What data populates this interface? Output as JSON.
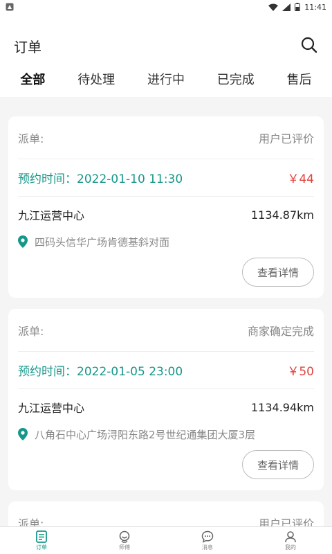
{
  "status_bar": {
    "time": "11:41",
    "notification_icon": "app-notification-icon"
  },
  "header": {
    "title": "订单",
    "search_icon": "search-icon",
    "tabs": [
      {
        "label": "全部",
        "active": true
      },
      {
        "label": "待处理",
        "active": false
      },
      {
        "label": "进行中",
        "active": false
      },
      {
        "label": "已完成",
        "active": false
      },
      {
        "label": "售后",
        "active": false
      }
    ]
  },
  "orders": [
    {
      "type_label": "派单:",
      "status": "用户已评价",
      "time_label": "预约时间：",
      "time_value": "2022-01-10 11:30",
      "price": "￥44",
      "center": "九江运营中心",
      "distance": "1134.87km",
      "address": "四码头信华广场肯德基斜对面",
      "detail_button": "查看详情"
    },
    {
      "type_label": "派单:",
      "status": "商家确定完成",
      "time_label": "预约时间：",
      "time_value": "2022-01-05 23:00",
      "price": "￥50",
      "center": "九江运营中心",
      "distance": "1134.94km",
      "address": "八角石中心广场浔阳东路2号世纪通集团大厦3层",
      "detail_button": "查看详情"
    },
    {
      "type_label": "派单:",
      "status": "用户已评价"
    }
  ],
  "bottom_nav": [
    {
      "label": "订单",
      "icon": "order-list-icon",
      "active": true
    },
    {
      "label": "师傅",
      "icon": "technician-icon",
      "active": false
    },
    {
      "label": "消息",
      "icon": "message-icon",
      "active": false
    },
    {
      "label": "我的",
      "icon": "profile-icon",
      "active": false
    }
  ],
  "colors": {
    "accent": "#17978a",
    "price": "#e2433e",
    "muted": "#888888",
    "background": "#f5f5f5"
  }
}
